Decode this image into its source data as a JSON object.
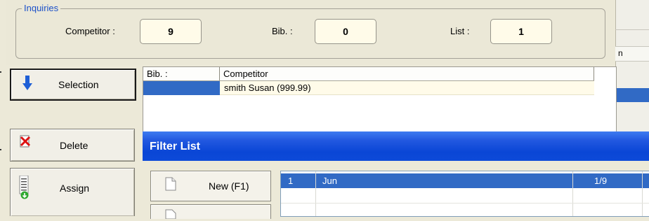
{
  "inquiries": {
    "legend": "Inquiries",
    "competitor_label": "Competitor :",
    "competitor_value": "9",
    "bib_label": "Bib. :",
    "bib_value": "0",
    "list_label": "List :",
    "list_value": "1"
  },
  "buttons": {
    "selection": "Selection",
    "delete": "Delete",
    "assign": "Assign"
  },
  "selection_grid": {
    "columns": [
      "Bib. :",
      "Competitor"
    ],
    "rows": [
      {
        "bib": "",
        "competitor": "smith Susan (999.99)"
      }
    ]
  },
  "background_window": {
    "column_fragment": "n"
  },
  "filter_list": {
    "title": "Filter List",
    "new_button": "New (F1)",
    "rows": [
      {
        "num": "1",
        "name": "Jun",
        "ratio": "1/9"
      }
    ]
  },
  "colors": {
    "selection_blue": "#316ac5",
    "title_blue": "#0a46d6",
    "field_bg": "#fffbe9",
    "legend_blue": "#1c51c9"
  },
  "icons": {
    "selection": "arrow-down-icon",
    "delete": "delete-x-icon",
    "assign": "list-add-icon",
    "new": "new-document-icon"
  }
}
